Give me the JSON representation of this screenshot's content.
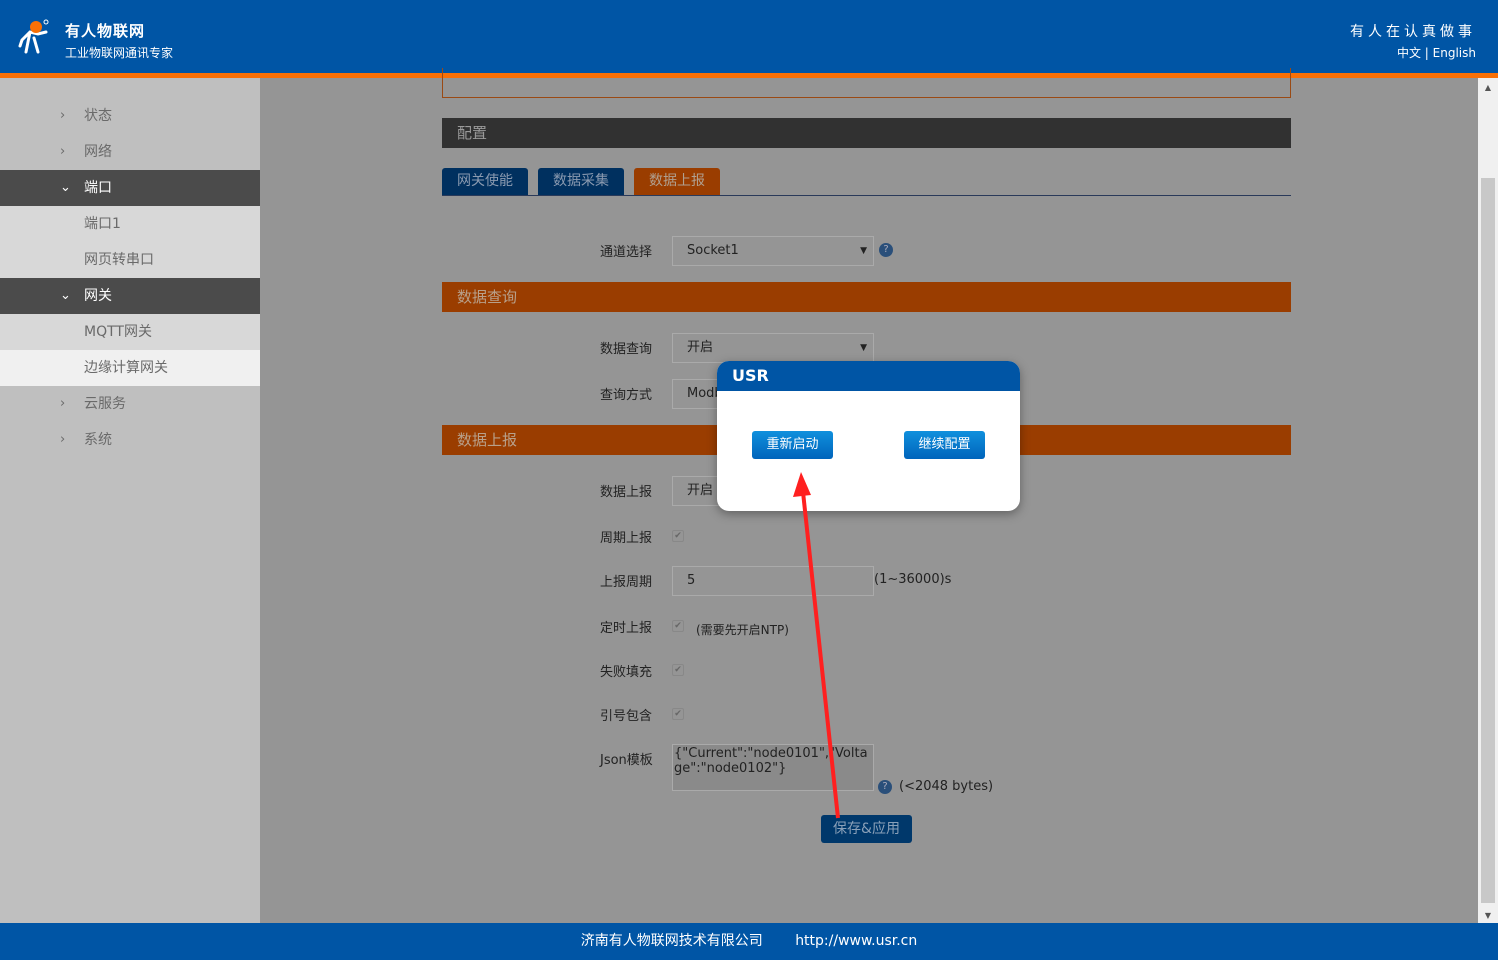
{
  "header": {
    "brand": "有人物联网",
    "subtitle": "工业物联网通讯专家",
    "slogan": "有人在认真做事",
    "lang_zh": "中文",
    "lang_sep": "|",
    "lang_en": "English"
  },
  "sidebar": {
    "items": [
      {
        "label": "状态",
        "state": "collapsed"
      },
      {
        "label": "网络",
        "state": "collapsed"
      },
      {
        "label": "端口",
        "state": "open"
      },
      {
        "label": "端口1",
        "state": "sub"
      },
      {
        "label": "网页转串口",
        "state": "sub"
      },
      {
        "label": "网关",
        "state": "open"
      },
      {
        "label": "MQTT网关",
        "state": "sub"
      },
      {
        "label": "边缘计算网关",
        "state": "selected"
      },
      {
        "label": "云服务",
        "state": "collapsed"
      },
      {
        "label": "系统",
        "state": "collapsed"
      }
    ]
  },
  "main": {
    "config_title": "配置",
    "tabs": [
      {
        "label": "网关使能"
      },
      {
        "label": "数据采集"
      },
      {
        "label": "数据上报",
        "active": true
      }
    ],
    "channel": {
      "label": "通道选择",
      "value": "Socket1"
    },
    "query_section": "数据查询",
    "query": {
      "label": "数据查询",
      "value": "开启"
    },
    "query_mode": {
      "label": "查询方式",
      "value": "Modbus"
    },
    "report_section": "数据上报",
    "report": {
      "label": "数据上报",
      "value": "开启"
    },
    "periodic": {
      "label": "周期上报",
      "checked": true
    },
    "period": {
      "label": "上报周期",
      "value": "5",
      "unit": "(1~36000)s"
    },
    "timed": {
      "label": "定时上报",
      "checked": true,
      "note": "(需要先开启NTP)"
    },
    "fail_fill": {
      "label": "失败填充",
      "checked": true
    },
    "quote": {
      "label": "引号包含",
      "checked": true
    },
    "json": {
      "label": "Json模板",
      "value": "{\"Current\":\"node0101\",\"Voltage\":\"node0102\"}",
      "note": "(<2048 bytes)"
    },
    "save_label": "保存&应用"
  },
  "dialog": {
    "title": "USR",
    "restart": "重新启动",
    "continue": "继续配置"
  },
  "footer": {
    "company": "济南有人物联网技术有限公司",
    "url": "http://www.usr.cn"
  },
  "colors": {
    "brand_blue": "#0055a5",
    "accent_orange": "#f97006",
    "annotation_arrow": "#ff2020"
  }
}
